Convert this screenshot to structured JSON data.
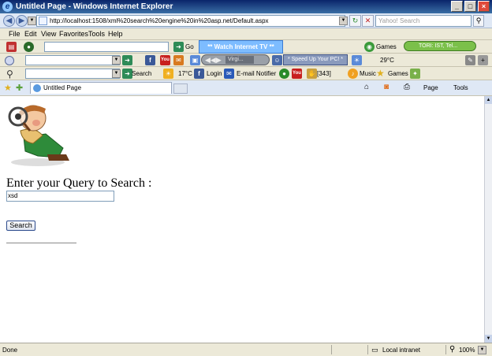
{
  "window": {
    "title": "Untitled Page - Windows Internet Explorer"
  },
  "address_bar": {
    "url": "http://localhost:1508/xml%20search%20engine%20in%20asp.net/Default.aspx",
    "search_placeholder": "Yahoo! Search"
  },
  "menu": {
    "items": [
      "File",
      "Edit",
      "View",
      "Favorites",
      "Tools",
      "Help"
    ]
  },
  "toolbar1": {
    "go_label": "Go",
    "tv_banner": "** Watch Internet TV **",
    "games_label": "Games",
    "tori_label": "TORI: IST, Tel..."
  },
  "toolbar2": {
    "player_text": "Virgi...",
    "speed_banner": "* Speed Up Your PC! *",
    "weather_temp": "29°C"
  },
  "toolbar3": {
    "search_label": "Search",
    "temp_label": "17°C",
    "login_label": "Login",
    "email_label": "E-mail Notifier",
    "count_label": "[343]",
    "music_label": "Music",
    "games_label": "Games"
  },
  "tabs": {
    "active_tab": "Untitled Page",
    "page_label": "Page",
    "tools_label": "Tools"
  },
  "page": {
    "prompt": "Enter your Query to Search :",
    "query_value": "xsd",
    "search_button": "Search"
  },
  "status": {
    "text": "Done",
    "zone": "Local intranet",
    "zoom": "100%"
  }
}
